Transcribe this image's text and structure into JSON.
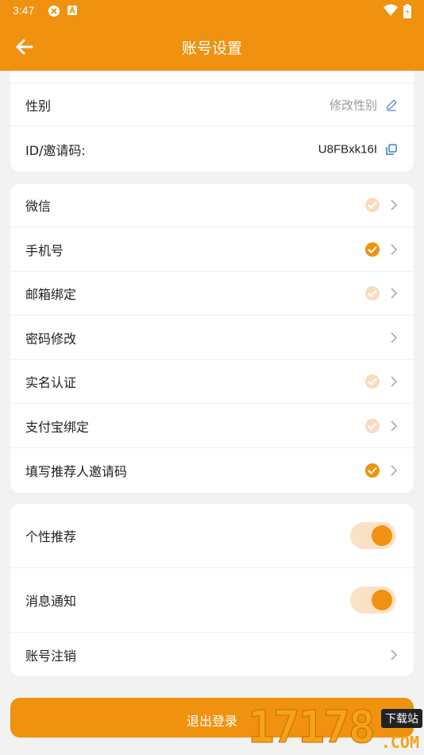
{
  "status_bar": {
    "time": "3:47"
  },
  "header": {
    "title": "账号设置"
  },
  "profile_card": {
    "gender": {
      "label": "性别",
      "value": "修改性别"
    },
    "invite": {
      "label": "ID/邀请码:",
      "value": "U8FBxk16I"
    }
  },
  "bindings": [
    {
      "label": "微信",
      "checked": false
    },
    {
      "label": "手机号",
      "checked": true
    },
    {
      "label": "邮箱绑定",
      "checked": false
    },
    {
      "label": "密码修改"
    },
    {
      "label": "实名认证",
      "checked": false
    },
    {
      "label": "支付宝绑定",
      "checked": false
    },
    {
      "label": "填写推荐人邀请码",
      "checked": true
    }
  ],
  "settings": {
    "personal_recommend": {
      "label": "个性推荐",
      "enabled": true
    },
    "notifications": {
      "label": "消息通知",
      "enabled": true
    },
    "cancel_account": {
      "label": "账号注销"
    }
  },
  "logout": {
    "label": "退出登录"
  },
  "watermark": {
    "digits": "17178",
    "tag": "下载站",
    "suffix": ".COM"
  },
  "colors": {
    "accent": "#f0920f",
    "accent_light": "#f8dcc0",
    "background": "#f2f2f2"
  }
}
